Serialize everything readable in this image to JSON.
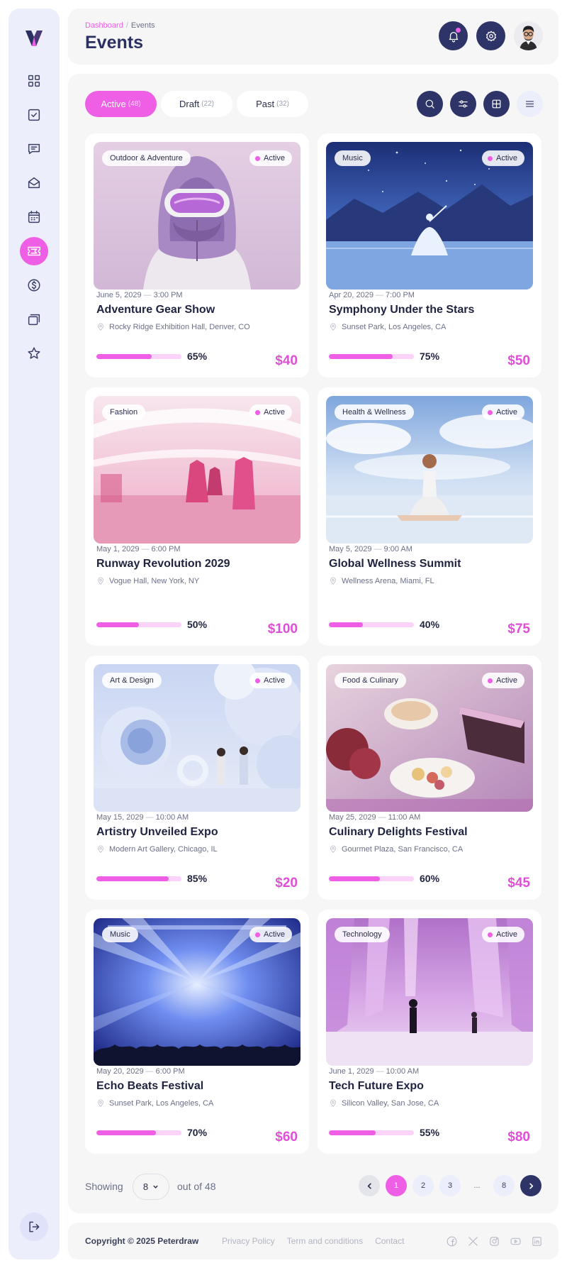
{
  "breadcrumb": {
    "parent": "Dashboard",
    "separator": "/",
    "current": "Events"
  },
  "page_title": "Events",
  "sidebar": {
    "items": [
      {
        "name": "grid-icon"
      },
      {
        "name": "checkbox-icon"
      },
      {
        "name": "message-icon"
      },
      {
        "name": "mail-icon"
      },
      {
        "name": "calendar-icon"
      },
      {
        "name": "ticket-icon",
        "active": true
      },
      {
        "name": "dollar-icon"
      },
      {
        "name": "cards-icon"
      },
      {
        "name": "star-icon"
      }
    ]
  },
  "tabs": [
    {
      "label": "Active",
      "count": "(48)",
      "active": true
    },
    {
      "label": "Draft",
      "count": "(22)"
    },
    {
      "label": "Past",
      "count": "(32)"
    }
  ],
  "colors": {
    "accent": "#ee5fe6",
    "navy": "#2e3467",
    "sidebar_bg": "#eceefc"
  },
  "events": [
    {
      "category": "Outdoor & Adventure",
      "status": "Active",
      "date": "June 5, 2029",
      "time": "3:00 PM",
      "title": "Adventure Gear Show",
      "location": "Rocky Ridge Exhibition Hall, Denver, CO",
      "progress": 0.65,
      "progress_label": "65%",
      "price": "$40"
    },
    {
      "category": "Music",
      "status": "Active",
      "date": "Apr 20, 2029",
      "time": "7:00 PM",
      "title": "Symphony Under the Stars",
      "location": "Sunset Park, Los Angeles, CA",
      "progress": 0.75,
      "progress_label": "75%",
      "price": "$50"
    },
    {
      "category": "Fashion",
      "status": "Active",
      "date": "May 1, 2029",
      "time": "6:00 PM",
      "title": "Runway Revolution 2029",
      "location": "Vogue Hall, New York, NY",
      "progress": 0.5,
      "progress_label": "50%",
      "price": "$100"
    },
    {
      "category": "Health & Wellness",
      "status": "Active",
      "date": "May 5, 2029",
      "time": "9:00 AM",
      "title": "Global Wellness Summit",
      "location": "Wellness Arena, Miami, FL",
      "progress": 0.4,
      "progress_label": "40%",
      "price": "$75"
    },
    {
      "category": "Art & Design",
      "status": "Active",
      "date": "May 15, 2029",
      "time": "10:00 AM",
      "title": "Artistry Unveiled Expo",
      "location": "Modern Art Gallery, Chicago, IL",
      "progress": 0.85,
      "progress_label": "85%",
      "price": "$20"
    },
    {
      "category": "Food & Culinary",
      "status": "Active",
      "date": "May 25, 2029",
      "time": "11:00 AM",
      "title": "Culinary Delights Festival",
      "location": "Gourmet Plaza, San Francisco, CA",
      "progress": 0.6,
      "progress_label": "60%",
      "price": "$45"
    },
    {
      "category": "Music",
      "status": "Active",
      "date": "May 20, 2029",
      "time": "6:00 PM",
      "title": "Echo Beats Festival",
      "location": "Sunset Park, Los Angeles, CA",
      "progress": 0.7,
      "progress_label": "70%",
      "price": "$60"
    },
    {
      "category": "Technology",
      "status": "Active",
      "date": "June 1, 2029",
      "time": "10:00 AM",
      "title": "Tech Future Expo",
      "location": "Silicon Valley, San Jose, CA",
      "progress": 0.55,
      "progress_label": "55%",
      "price": "$80"
    }
  ],
  "pagination": {
    "showing_label": "Showing",
    "per_page": "8",
    "out_of_label": "out of 48",
    "pages": [
      "1",
      "2",
      "3",
      "...",
      "8"
    ],
    "current": "1"
  },
  "footer": {
    "copyright": "Copyright © 2025 Peterdraw",
    "links": [
      "Privacy Policy",
      "Term and conditions",
      "Contact"
    ],
    "social": [
      "facebook-icon",
      "x-icon",
      "instagram-icon",
      "youtube-icon",
      "linkedin-icon"
    ]
  }
}
